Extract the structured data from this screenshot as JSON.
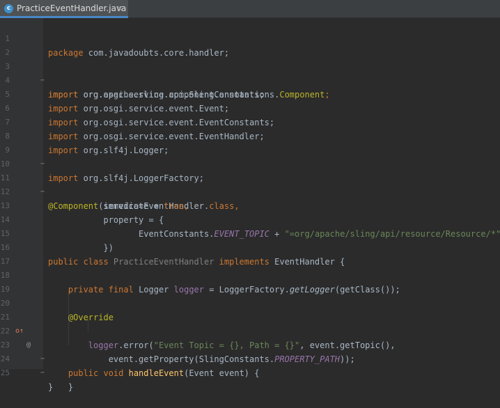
{
  "tab": {
    "icon_letter": "c",
    "title": "PracticeEventHandler.java",
    "close": "×"
  },
  "gutter_marks": {
    "override_impl": "o↑",
    "annotation": "@"
  },
  "code": {
    "l1": [
      "package",
      " com.javadoubts.core.handler;"
    ],
    "l3": [
      "import",
      " org.apache.sling.api.SlingConstants;"
    ],
    "l4": [
      "import",
      " org.osgi.service.component.annotations.",
      "Component",
      ";"
    ],
    "l5": [
      "import",
      " org.osgi.service.event.Event;"
    ],
    "l6": [
      "import",
      " org.osgi.service.event.EventConstants;"
    ],
    "l7": [
      "import",
      " org.osgi.service.event.EventHandler;"
    ],
    "l8": [
      "import",
      " org.slf4j.Logger;"
    ],
    "l9": [
      "import",
      " org.slf4j.LoggerFactory;"
    ],
    "l11": [
      "@Component",
      "(service=EventHandler.",
      "class",
      ","
    ],
    "l12": [
      "           immediate = ",
      "true",
      ","
    ],
    "l13": [
      "           property = {"
    ],
    "l14": [
      "                  EventConstants.",
      "EVENT_TOPIC",
      " + ",
      "\"=org/apache/sling/api/resource/Resource/*\""
    ],
    "l15": [
      "           })"
    ],
    "l16": [
      "public class ",
      "PracticeEventHandler",
      " implements ",
      "EventHandler {"
    ],
    "l18": [
      "    ",
      "private final ",
      "Logger ",
      "logger",
      " = LoggerFactory.",
      "getLogger",
      "(getClass());"
    ],
    "l20": [
      "    ",
      "@Override"
    ],
    "l21": [
      "    ",
      "public void ",
      "handleEvent",
      "(Event event) {"
    ],
    "l22": [
      "        ",
      "logger",
      ".error(",
      "\"Event Topic = {}, Path = {}\"",
      ", event.getTopic(),"
    ],
    "l23": [
      "            event.getProperty(SlingConstants.",
      "PROPERTY_PATH",
      "));"
    ],
    "l24": [
      "    }"
    ],
    "l25": [
      "}"
    ]
  },
  "line_numbers": [
    "1",
    "2",
    "3",
    "4",
    "5",
    "6",
    "7",
    "8",
    "9",
    "10",
    "11",
    "12",
    "13",
    "14",
    "15",
    "16",
    "17",
    "18",
    "19",
    "20",
    "21",
    "22",
    "23",
    "24",
    "25"
  ]
}
